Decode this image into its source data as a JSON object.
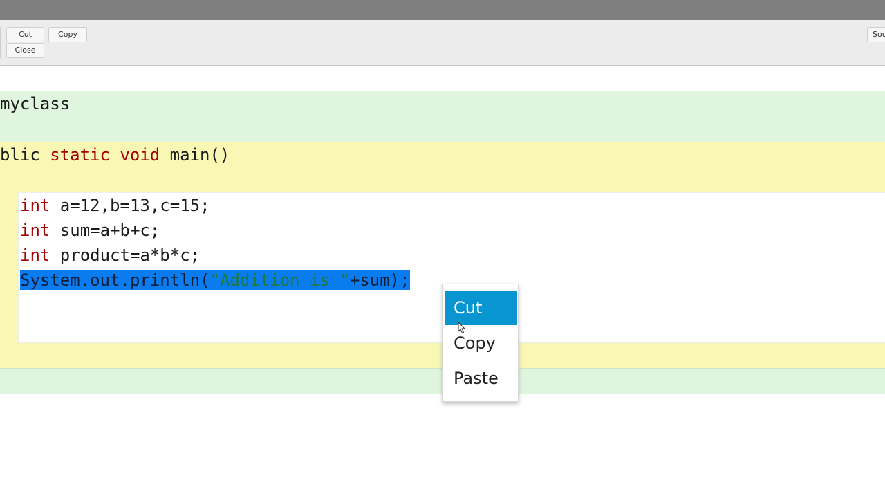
{
  "toolbar": {
    "cut_label": "Cut",
    "copy_label": "Copy",
    "close_label": "Close",
    "source_label": "Sou"
  },
  "editor": {
    "class_line": "myclass",
    "method_line": {
      "tokens": [
        "blic ",
        "static ",
        "void ",
        "main()"
      ]
    },
    "lines": [
      {
        "kw": "int",
        "rest": " a=12,b=13,c=15;"
      },
      {
        "kw": "int",
        "rest": " sum=a+b+c;"
      },
      {
        "kw": "int",
        "rest": " product=a*b*c;"
      }
    ],
    "selected_line": {
      "prefix": "System.out.println(",
      "string": "\"Addition is \"",
      "suffix": "+sum);"
    }
  },
  "context_menu": {
    "items": [
      {
        "label": "Cut",
        "active": true
      },
      {
        "label": "Copy",
        "active": false
      },
      {
        "label": "Paste",
        "active": false
      }
    ]
  },
  "colors": {
    "keyword": "#a40000",
    "string": "#2f8a2f",
    "selection": "#0a7cf0",
    "menu_highlight": "#0996d0",
    "class_band": "#dff5dd",
    "method_band": "#f9f7b4"
  }
}
